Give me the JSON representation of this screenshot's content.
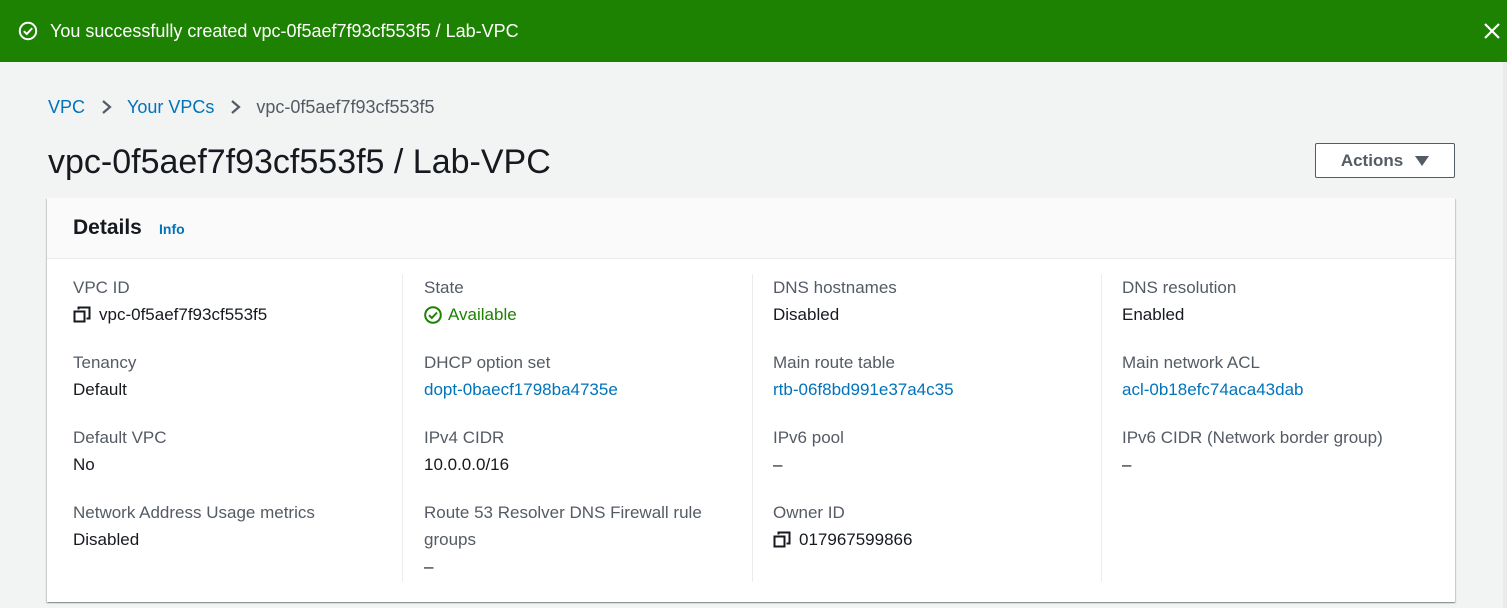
{
  "flash": {
    "message": "You successfully created vpc-0f5aef7f93cf553f5 / Lab-VPC",
    "status_icon": "success-circle-icon",
    "close_icon": "close-icon",
    "color": "#1d8102"
  },
  "breadcrumb": {
    "items": [
      "VPC",
      "Your VPCs"
    ],
    "current": "vpc-0f5aef7f93cf553f5"
  },
  "page": {
    "title": "vpc-0f5aef7f93cf553f5 / Lab-VPC",
    "actions_label": "Actions"
  },
  "details": {
    "title": "Details",
    "info_label": "Info",
    "columns": [
      [
        {
          "label": "VPC ID",
          "value": "vpc-0f5aef7f93cf553f5",
          "kind": "copy"
        },
        {
          "label": "Tenancy",
          "value": "Default",
          "kind": "text"
        },
        {
          "label": "Default VPC",
          "value": "No",
          "kind": "text"
        },
        {
          "label": "Network Address Usage metrics",
          "value": "Disabled",
          "kind": "text"
        }
      ],
      [
        {
          "label": "State",
          "value": "Available",
          "kind": "status"
        },
        {
          "label": "DHCP option set",
          "value": "dopt-0baecf1798ba4735e",
          "kind": "link"
        },
        {
          "label": "IPv4 CIDR",
          "value": "10.0.0.0/16",
          "kind": "text"
        },
        {
          "label": "Route 53 Resolver DNS Firewall rule groups",
          "value": "–",
          "kind": "text"
        }
      ],
      [
        {
          "label": "DNS hostnames",
          "value": "Disabled",
          "kind": "text"
        },
        {
          "label": "Main route table",
          "value": "rtb-06f8bd991e37a4c35",
          "kind": "link"
        },
        {
          "label": "IPv6 pool",
          "value": "–",
          "kind": "text"
        },
        {
          "label": "Owner ID",
          "value": "017967599866",
          "kind": "copy"
        }
      ],
      [
        {
          "label": "DNS resolution",
          "value": "Enabled",
          "kind": "text"
        },
        {
          "label": "Main network ACL",
          "value": "acl-0b18efc74aca43dab",
          "kind": "link"
        },
        {
          "label": "IPv6 CIDR (Network border group)",
          "value": "–",
          "kind": "text"
        }
      ]
    ]
  },
  "colors": {
    "link": "#0073bb",
    "success": "#1d8102",
    "label": "#545b64",
    "text": "#16191f"
  }
}
